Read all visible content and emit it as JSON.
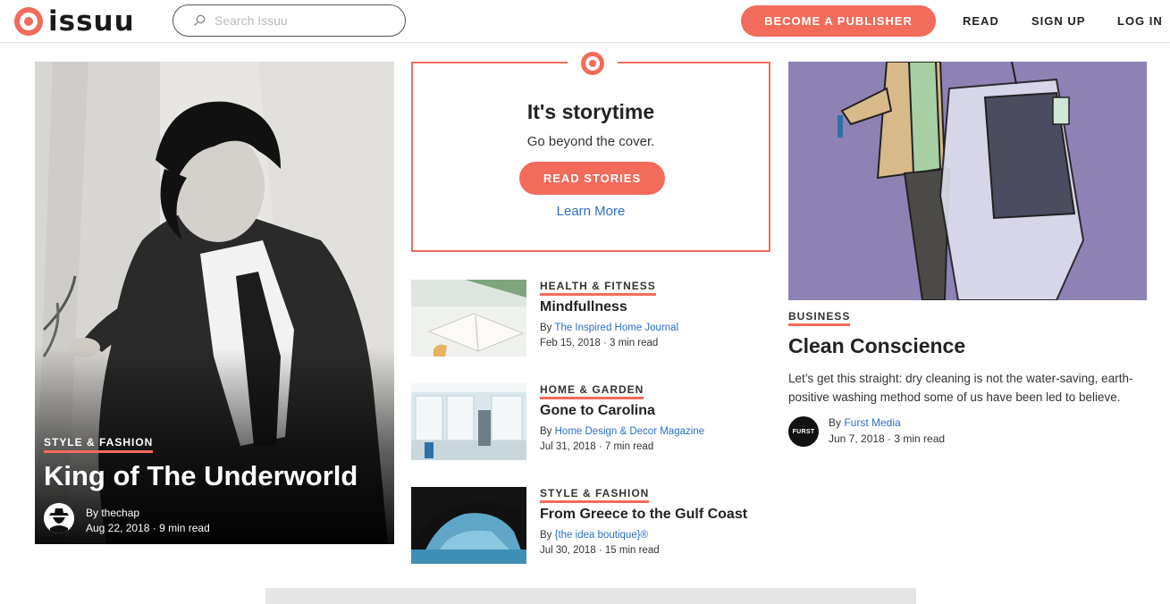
{
  "header": {
    "logo_text": "issuu",
    "search_placeholder": "Search Issuu",
    "publisher_button": "BECOME A PUBLISHER",
    "nav": [
      "READ",
      "SIGN UP",
      "LOG IN"
    ]
  },
  "feature": {
    "category": "STYLE & FASHION",
    "title": "King of The Underworld",
    "author_prefix": "By ",
    "author": "thechap",
    "date": "Aug 22, 2018",
    "read_time": "9 min read"
  },
  "storytime": {
    "title": "It's storytime",
    "subtitle": "Go beyond the cover.",
    "button": "READ STORIES",
    "link": "Learn More"
  },
  "articles": [
    {
      "category": "HEALTH & FITNESS",
      "title": "Mindfullness",
      "author_prefix": "By ",
      "author": "The Inspired Home Journal",
      "meta": "Feb 15, 2018 · 3 min read"
    },
    {
      "category": "HOME & GARDEN",
      "title": "Gone to Carolina",
      "author_prefix": "By ",
      "author": "Home Design & Decor Magazine",
      "meta": "Jul 31, 2018 · 7 min read"
    },
    {
      "category": "STYLE & FASHION",
      "title": "From Greece to the Gulf Coast",
      "author_prefix": "By ",
      "author": "{the idea boutique}®",
      "meta": "Jul 30, 2018 · 15 min read"
    }
  ],
  "right_feature": {
    "category": "BUSINESS",
    "title": "Clean Conscience",
    "description": "Let’s get this straight: dry cleaning is not the water-saving, earth-positive washing method some of us have been led to believe.",
    "avatar_text": "FURST",
    "author_prefix": "By ",
    "author": "Furst Media",
    "meta": "Jun 7, 2018 · 3 min read"
  },
  "colors": {
    "accent": "#f36b5b",
    "link": "#2d6ec9",
    "right_image_bg": "#8e82b5"
  }
}
